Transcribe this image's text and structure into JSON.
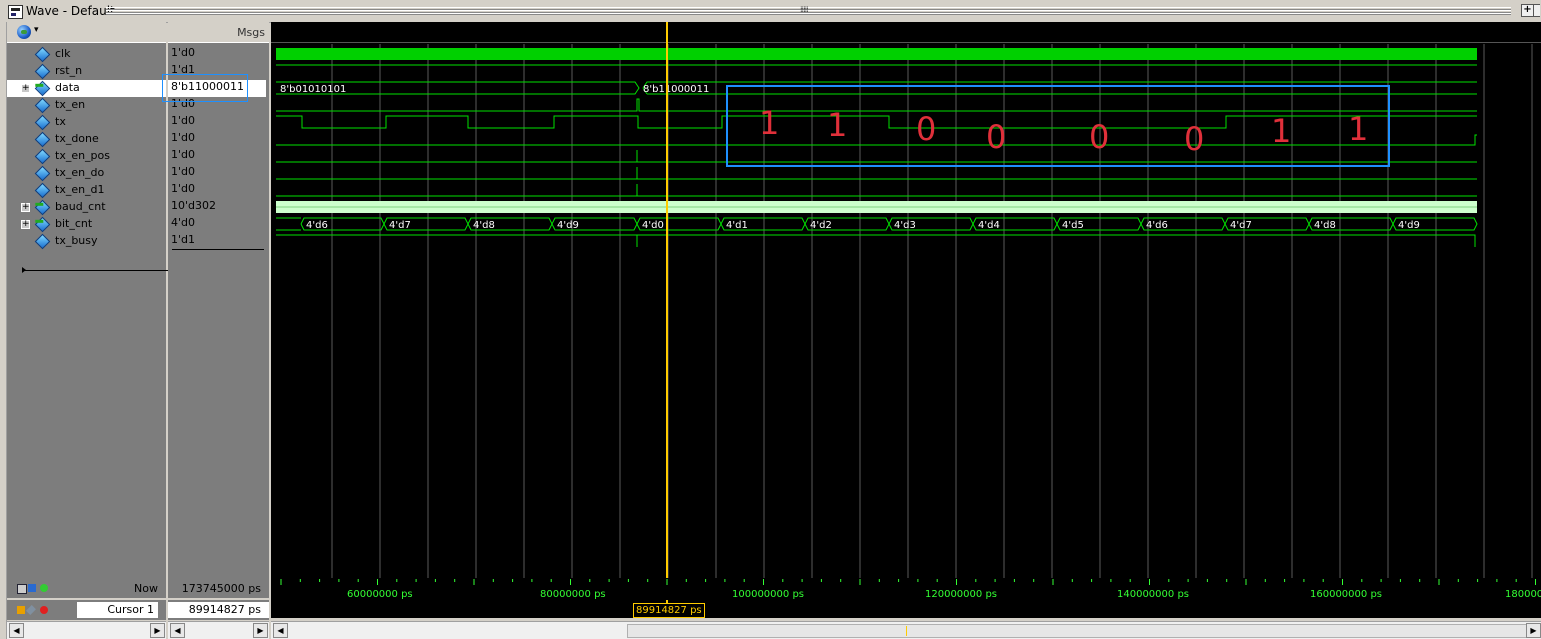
{
  "window": {
    "title": "Wave - Default"
  },
  "panes": {
    "msgs_header": "Msgs"
  },
  "signals": [
    {
      "name": "clk",
      "value": "1'd0",
      "expandable": false
    },
    {
      "name": "rst_n",
      "value": "1'd1",
      "expandable": false
    },
    {
      "name": "data",
      "value": "8'b11000011",
      "expandable": true
    },
    {
      "name": "tx_en",
      "value": "1'd0",
      "expandable": false
    },
    {
      "name": "tx",
      "value": "1'd0",
      "expandable": false
    },
    {
      "name": "tx_done",
      "value": "1'd0",
      "expandable": false
    },
    {
      "name": "tx_en_pos",
      "value": "1'd0",
      "expandable": false
    },
    {
      "name": "tx_en_do",
      "value": "1'd0",
      "expandable": false
    },
    {
      "name": "tx_en_d1",
      "value": "1'd0",
      "expandable": false
    },
    {
      "name": "baud_cnt",
      "value": "10'd302",
      "expandable": true
    },
    {
      "name": "bit_cnt",
      "value": "4'd0",
      "expandable": true
    },
    {
      "name": "tx_busy",
      "value": "1'd1",
      "expandable": false
    }
  ],
  "selected_signal": "data",
  "waves": {
    "data_values": [
      "8'b01010101",
      "8'b11000011"
    ],
    "bit_cnt_values": [
      "4'd6",
      "4'd7",
      "4'd8",
      "4'd9",
      "4'd0",
      "4'd1",
      "4'd2",
      "4'd3",
      "4'd4",
      "4'd5",
      "4'd6",
      "4'd7",
      "4'd8",
      "4'd9"
    ],
    "annotation_bits": [
      "1",
      "1",
      "0",
      "0",
      "0",
      "0",
      "1",
      "1"
    ]
  },
  "footer": {
    "now_label": "Now",
    "now_value": "173745000 ps",
    "cursor_label": "Cursor 1",
    "cursor_value": "89914827 ps",
    "cursor_flag": "89914827 ps",
    "time_labels": [
      "60000000 ps",
      "80000000 ps",
      "100000000 ps",
      "120000000 ps",
      "140000000 ps",
      "160000000 ps",
      "1800000"
    ]
  },
  "colors": {
    "wave": "#00e000",
    "bus": "#ccffcc",
    "cursor": "#ffcc00",
    "annotation": "#e0303a",
    "annotation_box": "#1e90ff",
    "grid": "#606060"
  }
}
